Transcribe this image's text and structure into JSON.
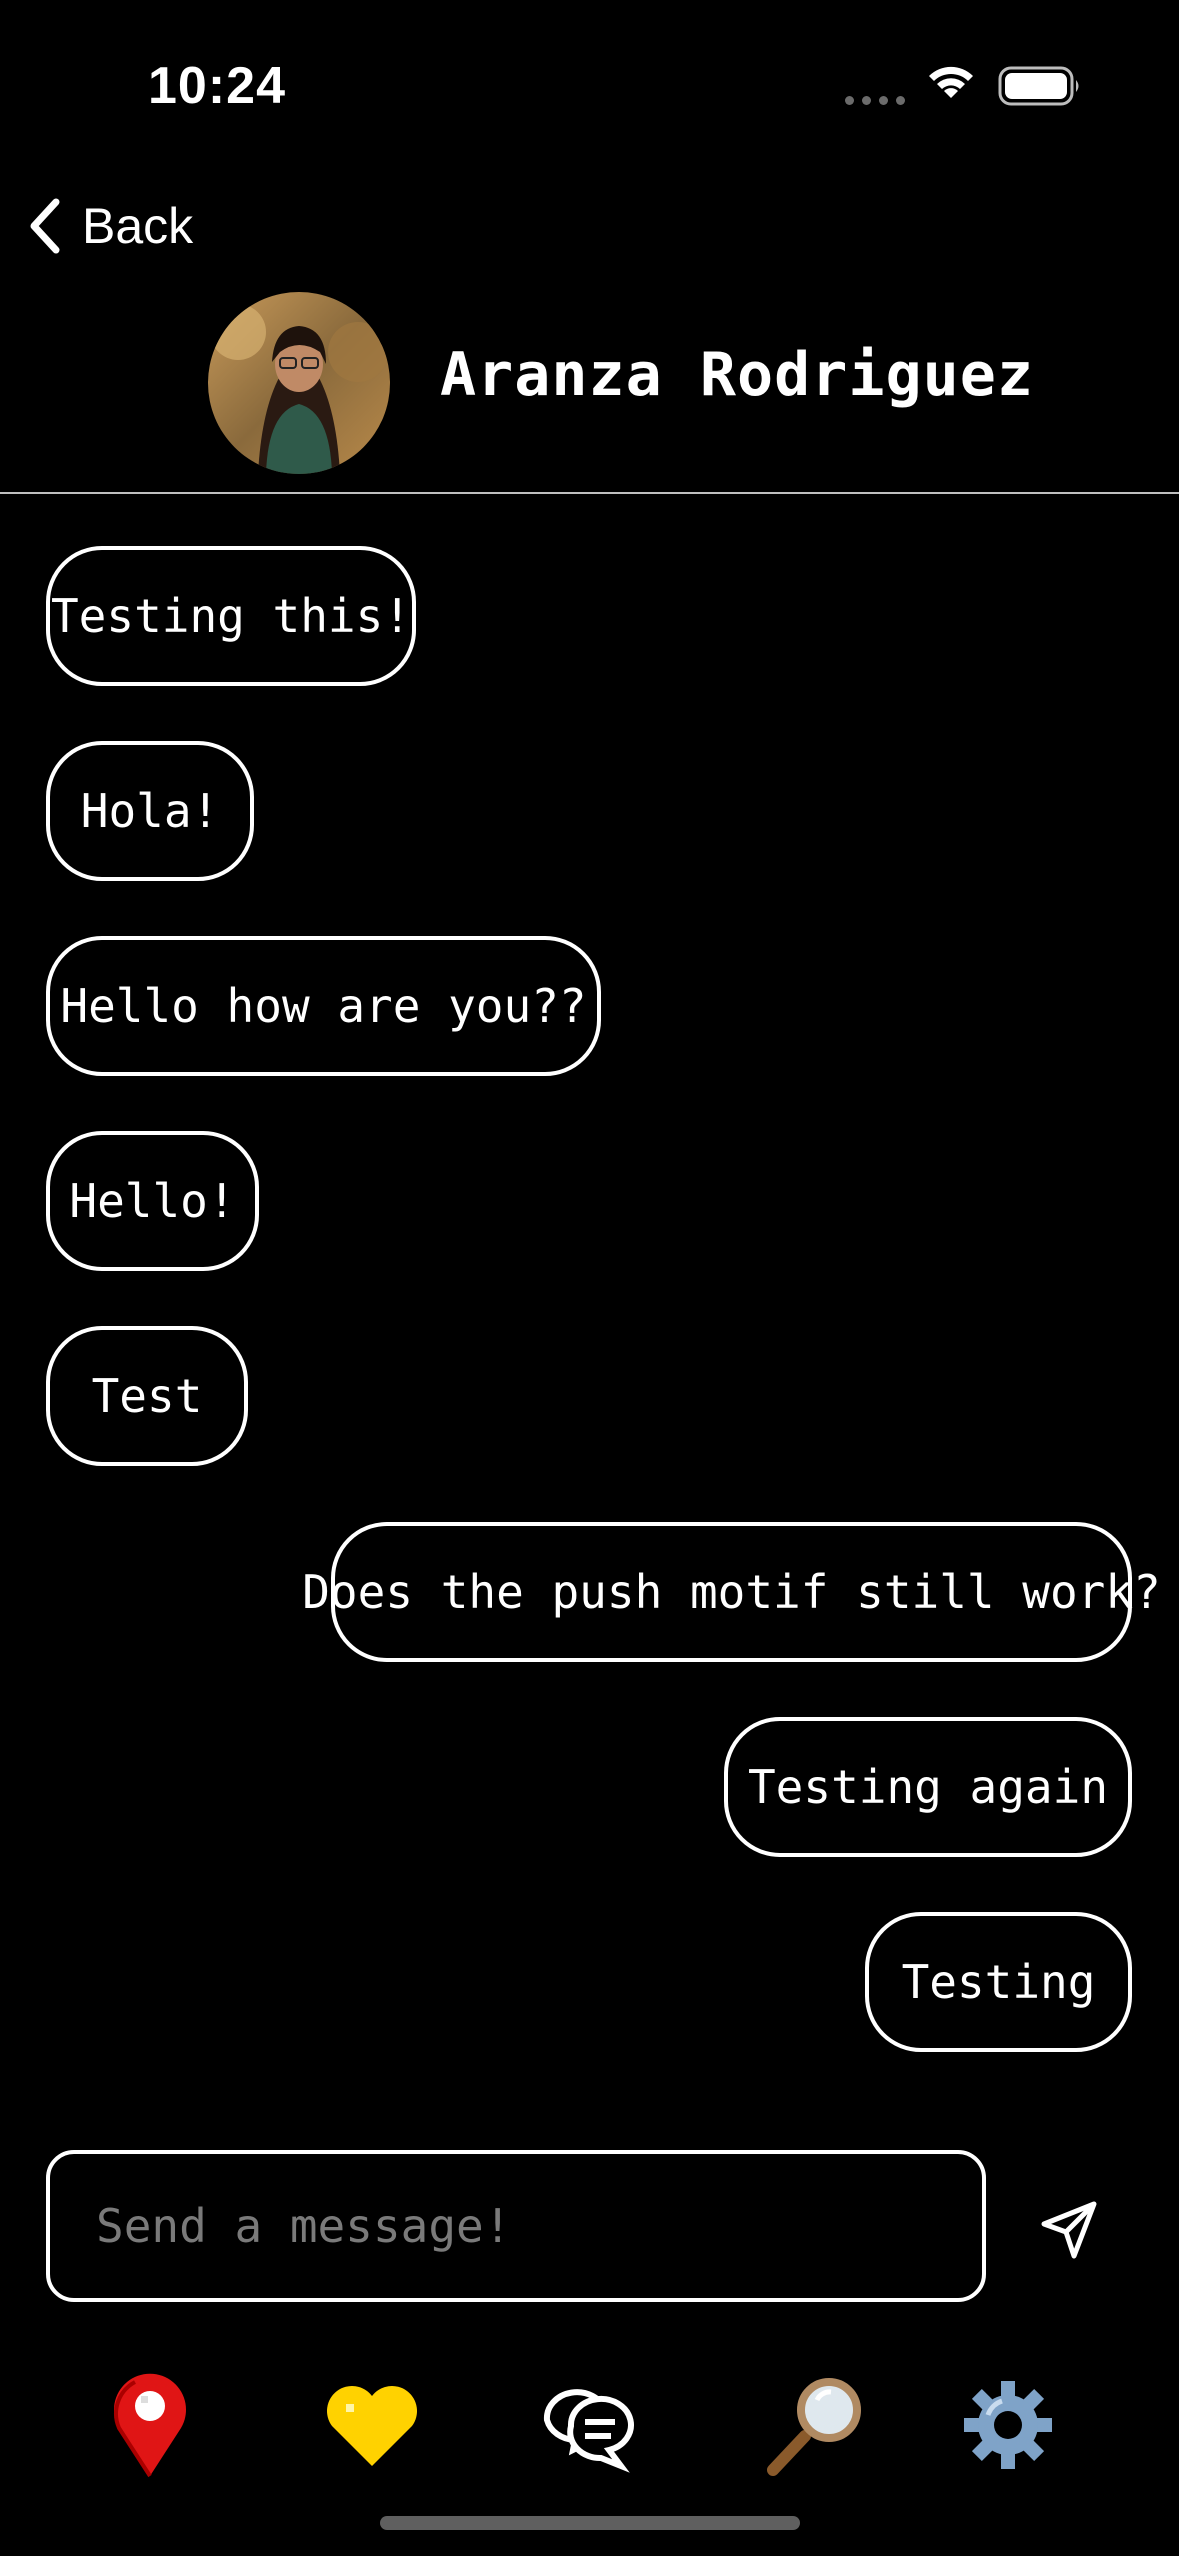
{
  "status_bar": {
    "time": "10:24"
  },
  "nav": {
    "back_label": "Back"
  },
  "contact": {
    "name": "Aranza Rodriguez"
  },
  "messages": [
    {
      "text": "Testing this!",
      "from": "received"
    },
    {
      "text": "Hola!",
      "from": "received"
    },
    {
      "text": "Hello how are you??",
      "from": "received"
    },
    {
      "text": "Hello!",
      "from": "received"
    },
    {
      "text": "Test",
      "from": "received"
    },
    {
      "text": "Does the push motif still work?",
      "from": "sent"
    },
    {
      "text": "Testing again",
      "from": "sent"
    },
    {
      "text": "Testing",
      "from": "sent"
    }
  ],
  "composer": {
    "placeholder": "Send a message!"
  },
  "tabs": [
    {
      "icon": "map-pin-icon",
      "color": "#e01515"
    },
    {
      "icon": "heart-icon",
      "color": "#ffd200"
    },
    {
      "icon": "chat-bubbles-icon",
      "color": "#ffffff"
    },
    {
      "icon": "magnifier-icon",
      "color": "#c9a27a"
    },
    {
      "icon": "gear-icon",
      "color": "#7fa3c8"
    }
  ]
}
